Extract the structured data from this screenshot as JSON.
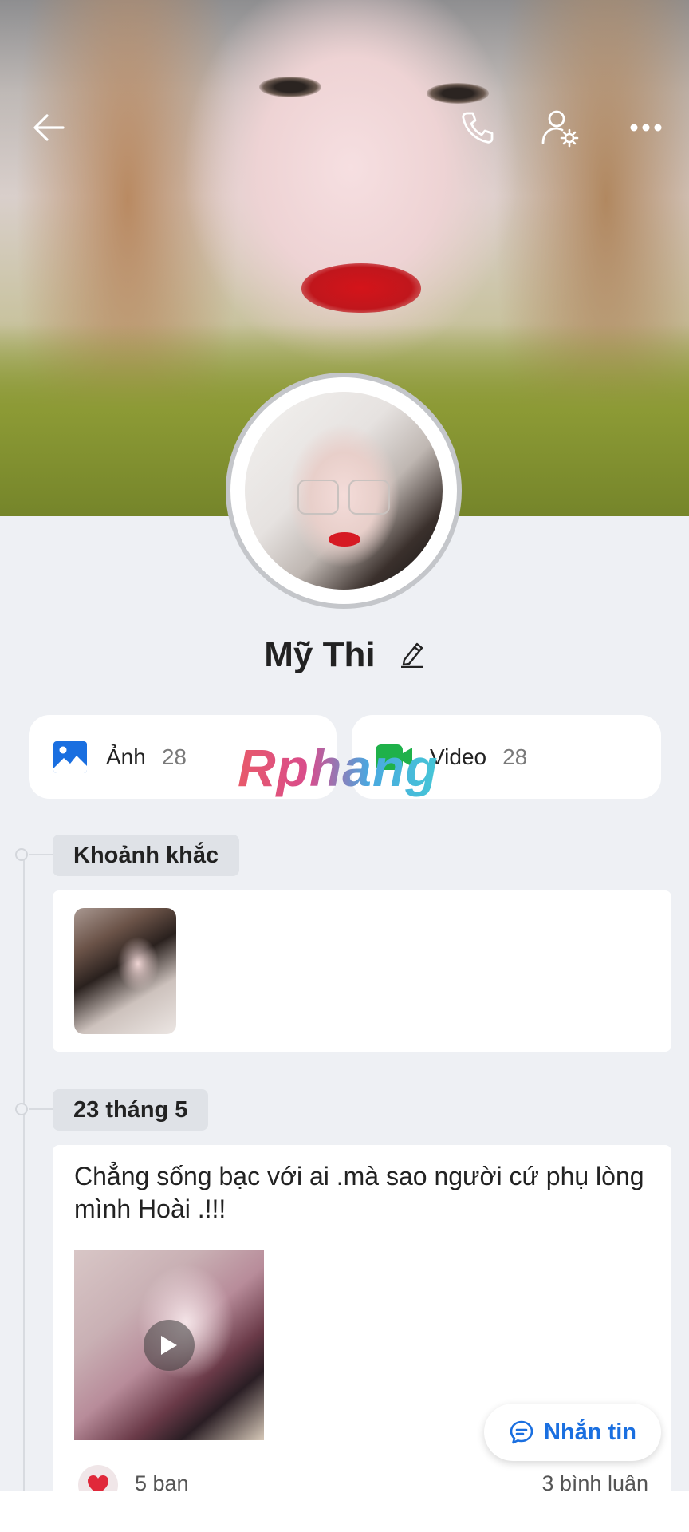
{
  "profile": {
    "name": "Mỹ Thi"
  },
  "topbar": {
    "back_icon": "arrow-left-icon",
    "call_icon": "phone-icon",
    "settings_icon": "user-settings-icon",
    "more_icon": "more-horizontal-icon"
  },
  "media": {
    "photos": {
      "label": "Ảnh",
      "count": "28",
      "icon": "image-icon"
    },
    "videos": {
      "label": "Video",
      "count": "28",
      "icon": "video-icon"
    }
  },
  "watermark": "Rphang",
  "timeline": {
    "moments_label": "Khoảnh khắc",
    "post_date": "23 tháng 5",
    "post_text": "Chẳng sống bạc với ai .mà sao người cứ phụ lòng mình Hoài .!!!",
    "likes": "5 bạn",
    "comments": "3 bình luận"
  },
  "message_button": {
    "label": "Nhắn tin",
    "icon": "chat-bubble-icon"
  },
  "colors": {
    "accent": "#1a6fe0",
    "background": "#eef0f4",
    "like_red": "#e0283a"
  }
}
